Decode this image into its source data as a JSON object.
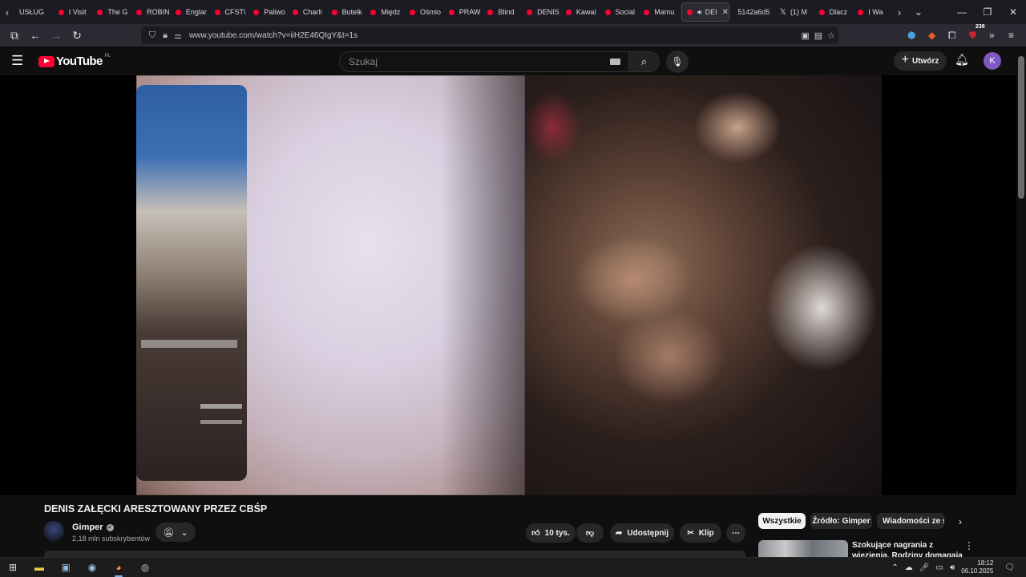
{
  "browser": {
    "tabs": [
      {
        "label": "USŁUG"
      },
      {
        "label": "I Visit"
      },
      {
        "label": "The G"
      },
      {
        "label": "ROBIN"
      },
      {
        "label": "Englar"
      },
      {
        "label": "CFST\\"
      },
      {
        "label": "Paliwo"
      },
      {
        "label": "Charli"
      },
      {
        "label": "Butelk"
      },
      {
        "label": "Międz"
      },
      {
        "label": "Ośmio"
      },
      {
        "label": "PRAW"
      },
      {
        "label": "Blind"
      },
      {
        "label": "DENIS"
      },
      {
        "label": "Kawal"
      },
      {
        "label": "Social"
      },
      {
        "label": "Mamu"
      },
      {
        "label": "DEI",
        "active": true
      },
      {
        "label": "5142a6d5"
      },
      {
        "label": "(1) M"
      },
      {
        "label": "Dlacz"
      },
      {
        "label": "I Wa"
      }
    ],
    "url": "www.youtube.com/watch?v=iiH2E46QIgY&t=1s",
    "extension_badge": "236"
  },
  "youtube": {
    "logo_text": "YouTube",
    "country_code": "PL",
    "search_placeholder": "Szukaj",
    "create_label": "Utwórz",
    "avatar_letter": "K",
    "accent_color": "#ff0033"
  },
  "video": {
    "title": "DENIS ZAŁĘCKI ARESZTOWANY PRZEZ CBŚP",
    "channel_name": "Gimper",
    "subscribers": "2,18 mln subskrybentów",
    "likes": "10 tys.",
    "share_label": "Udostępnij",
    "clip_label": "Klip"
  },
  "chips": [
    {
      "label": "Wszystkie",
      "active": true
    },
    {
      "label": "Źródło: Gimper"
    },
    {
      "label": "Wiadomości ze św"
    }
  ],
  "recommendation": {
    "title": "Szokujące nagrania z więzienia. Rodziny domagają się"
  },
  "taskbar": {
    "time": "18:12",
    "date": "06.10.2025"
  }
}
